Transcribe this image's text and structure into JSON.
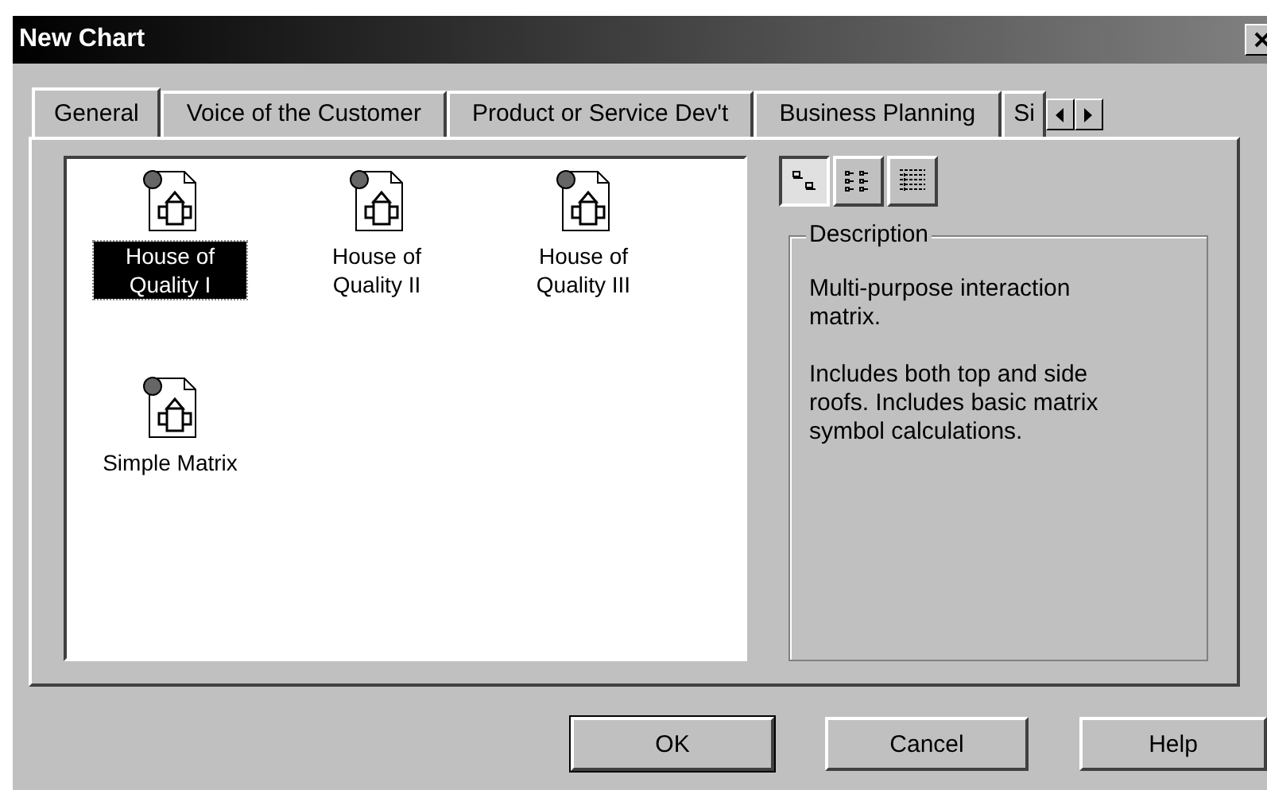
{
  "window": {
    "title": "New Chart"
  },
  "tabs": [
    {
      "label": "General",
      "selected": true
    },
    {
      "label": "Voice of the Customer",
      "selected": false
    },
    {
      "label": "Product or Service Dev't",
      "selected": false
    },
    {
      "label": "Business Planning",
      "selected": false
    },
    {
      "label": "Si",
      "selected": false
    }
  ],
  "templates": [
    {
      "label": "House of Quality I",
      "selected": true
    },
    {
      "label": "House of Quality II",
      "selected": false
    },
    {
      "label": "House of Quality III",
      "selected": false
    },
    {
      "label": "Simple Matrix",
      "selected": false
    }
  ],
  "view_buttons": [
    {
      "kind": "large",
      "selected": true
    },
    {
      "kind": "list",
      "selected": false
    },
    {
      "kind": "details",
      "selected": false
    }
  ],
  "description": {
    "title": "Description",
    "paragraphs": [
      "Multi-purpose interaction matrix.",
      "Includes both top and side roofs.  Includes basic matrix symbol calculations."
    ]
  },
  "buttons": [
    {
      "label": "OK",
      "default": true
    },
    {
      "label": "Cancel",
      "default": false
    },
    {
      "label": "Help",
      "default": false
    }
  ]
}
